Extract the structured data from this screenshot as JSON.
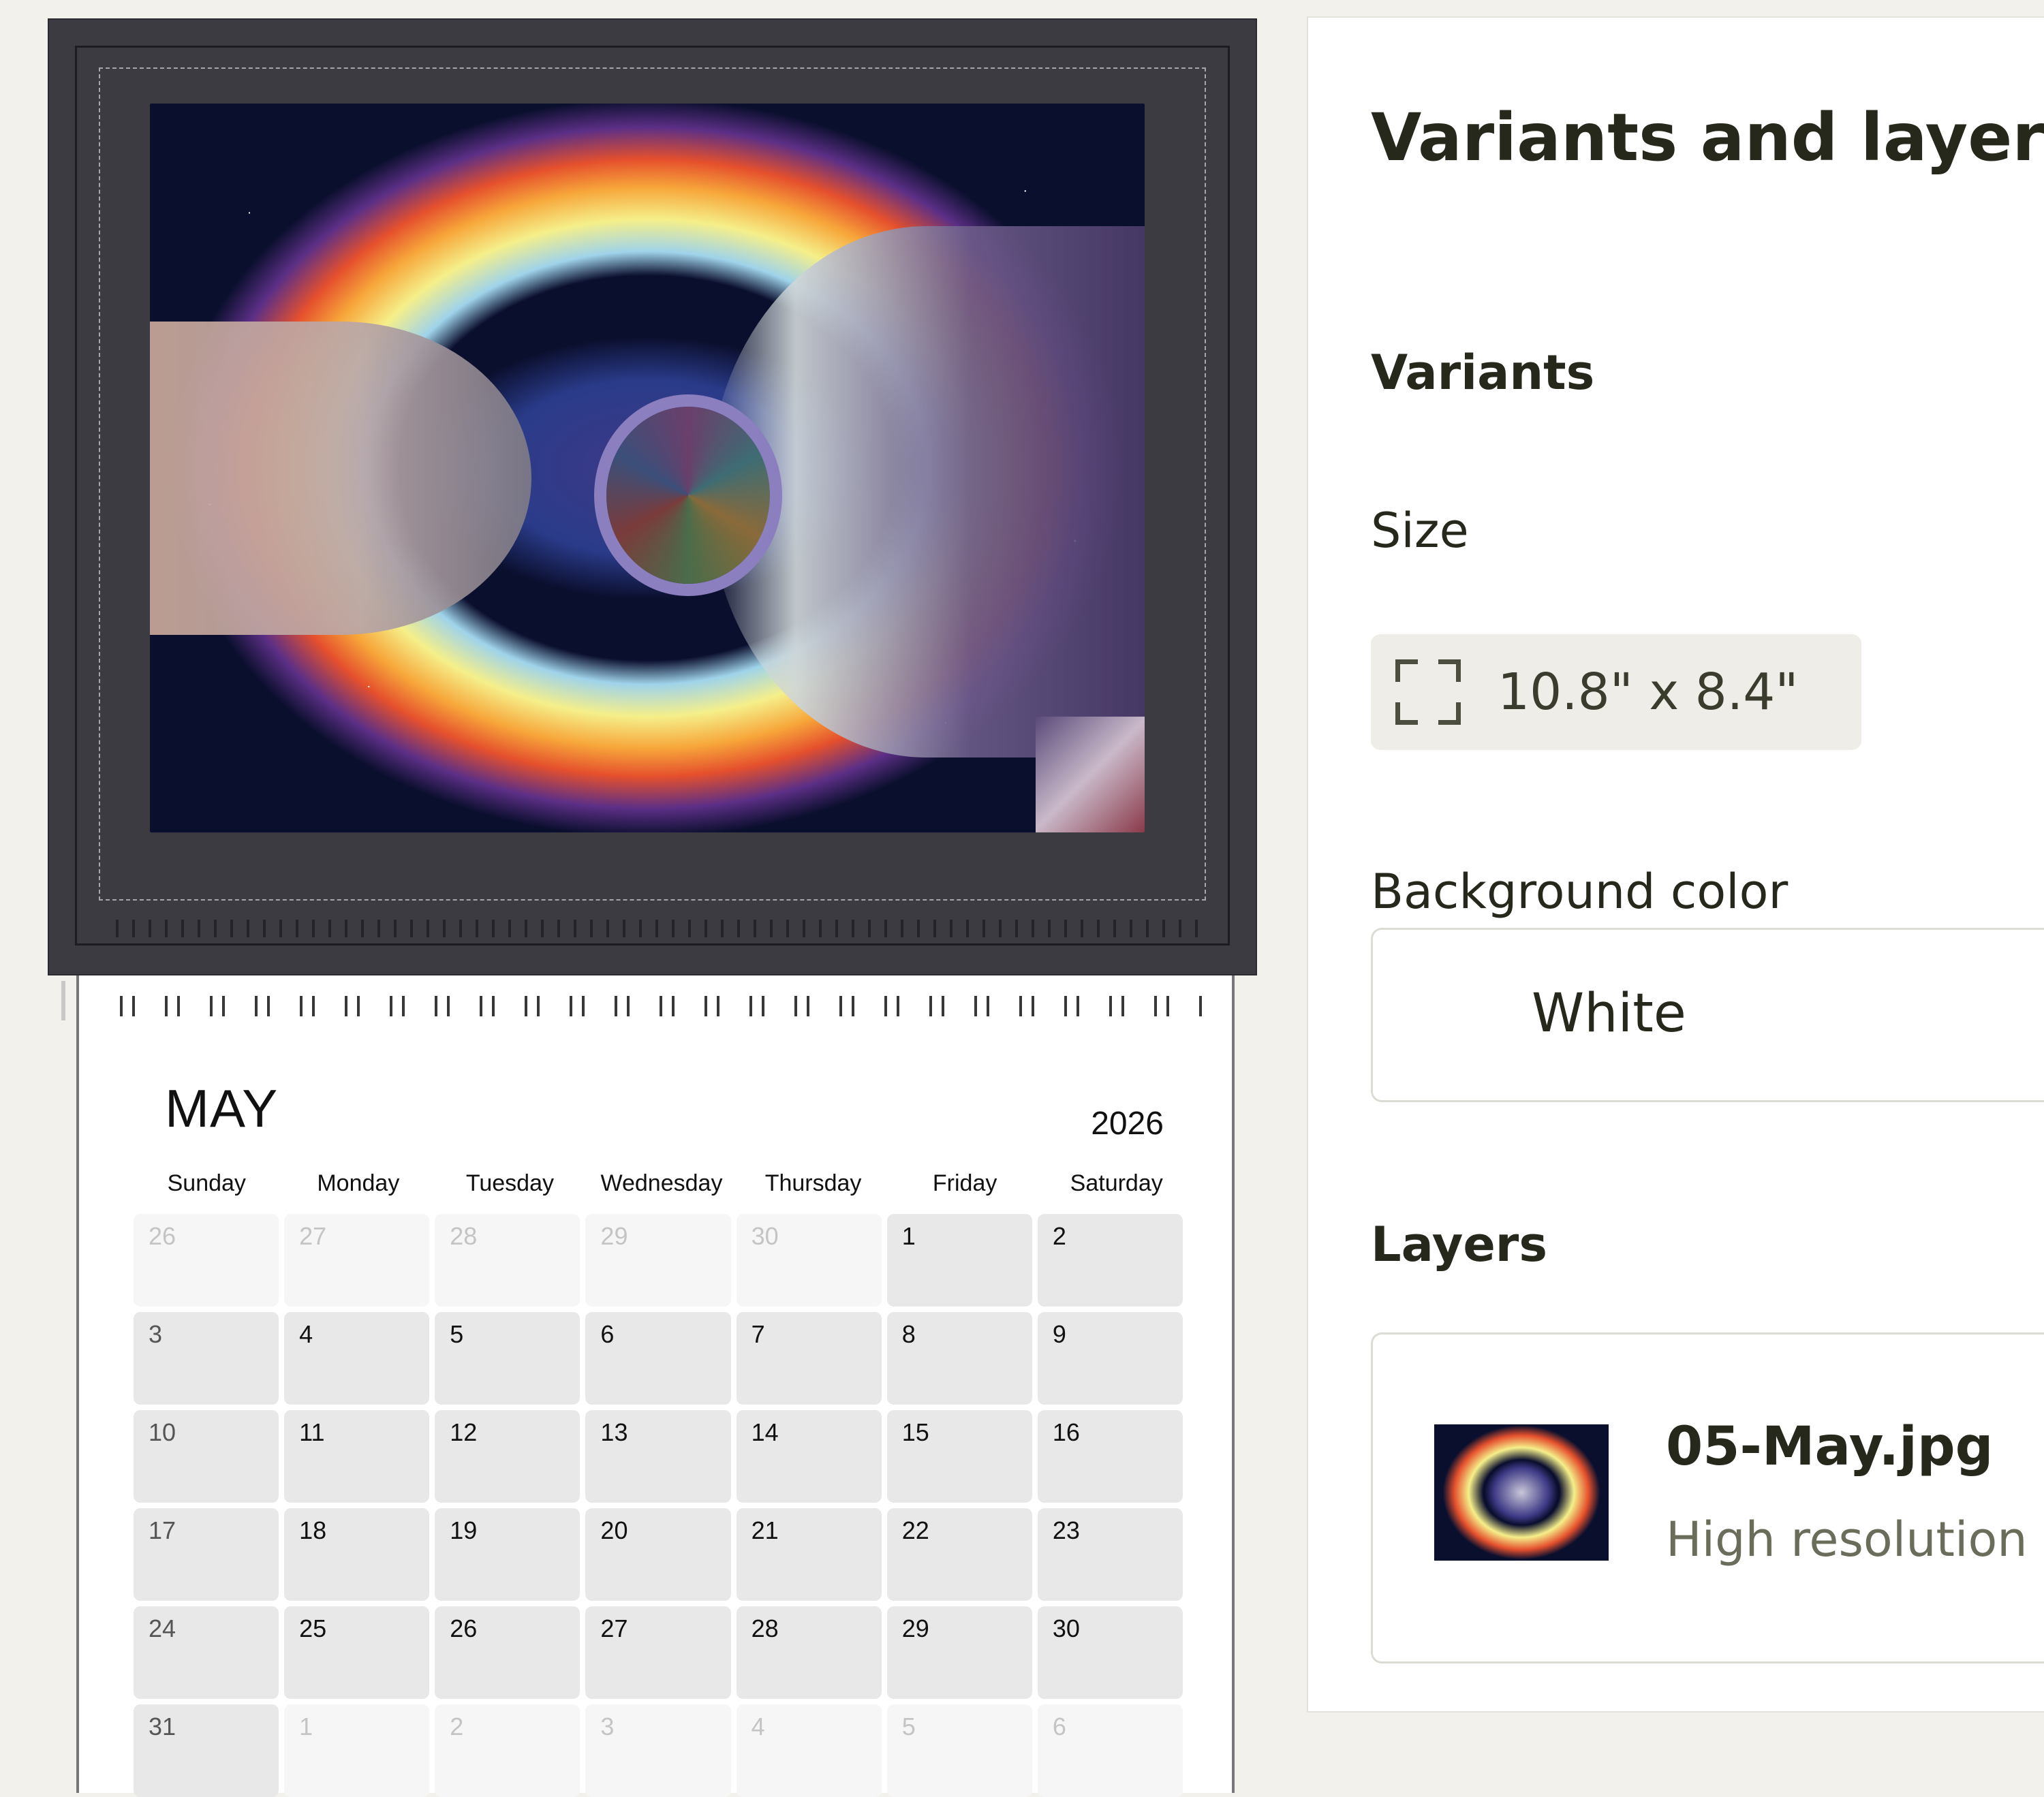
{
  "calendar": {
    "month": "MAY",
    "year": "2026",
    "weekdays": [
      "Sunday",
      "Monday",
      "Tuesday",
      "Wednesday",
      "Thursday",
      "Friday",
      "Saturday"
    ],
    "weeks": [
      [
        {
          "d": "26",
          "o": true
        },
        {
          "d": "27",
          "o": true
        },
        {
          "d": "28",
          "o": true
        },
        {
          "d": "29",
          "o": true
        },
        {
          "d": "30",
          "o": true
        },
        {
          "d": "1"
        },
        {
          "d": "2"
        }
      ],
      [
        {
          "d": "3"
        },
        {
          "d": "4"
        },
        {
          "d": "5"
        },
        {
          "d": "6"
        },
        {
          "d": "7"
        },
        {
          "d": "8"
        },
        {
          "d": "9"
        }
      ],
      [
        {
          "d": "10"
        },
        {
          "d": "11"
        },
        {
          "d": "12"
        },
        {
          "d": "13"
        },
        {
          "d": "14"
        },
        {
          "d": "15"
        },
        {
          "d": "16"
        }
      ],
      [
        {
          "d": "17"
        },
        {
          "d": "18"
        },
        {
          "d": "19"
        },
        {
          "d": "20"
        },
        {
          "d": "21"
        },
        {
          "d": "22"
        },
        {
          "d": "23"
        }
      ],
      [
        {
          "d": "24"
        },
        {
          "d": "25"
        },
        {
          "d": "26"
        },
        {
          "d": "27"
        },
        {
          "d": "28"
        },
        {
          "d": "29"
        },
        {
          "d": "30"
        }
      ],
      [
        {
          "d": "31"
        },
        {
          "d": "1",
          "o": true
        },
        {
          "d": "2",
          "o": true
        },
        {
          "d": "3",
          "o": true
        },
        {
          "d": "4",
          "o": true
        },
        {
          "d": "5",
          "o": true
        },
        {
          "d": "6",
          "o": true
        }
      ]
    ]
  },
  "panel": {
    "title": "Variants and layers",
    "variants_heading": "Variants",
    "size_label": "Size",
    "size_value": "10.8\" x 8.4\"",
    "size_icon": "frame-corners-icon",
    "background_label": "Background color",
    "background_value": "White",
    "layers_heading": "Layers",
    "layer": {
      "name": "05-May.jpg",
      "subtitle": "High resolution"
    }
  },
  "colors": {
    "page_bg": "#f2f1ec",
    "text_dark": "#26281b",
    "chip_bg": "#eeede7",
    "frame": "#3c3b41"
  }
}
